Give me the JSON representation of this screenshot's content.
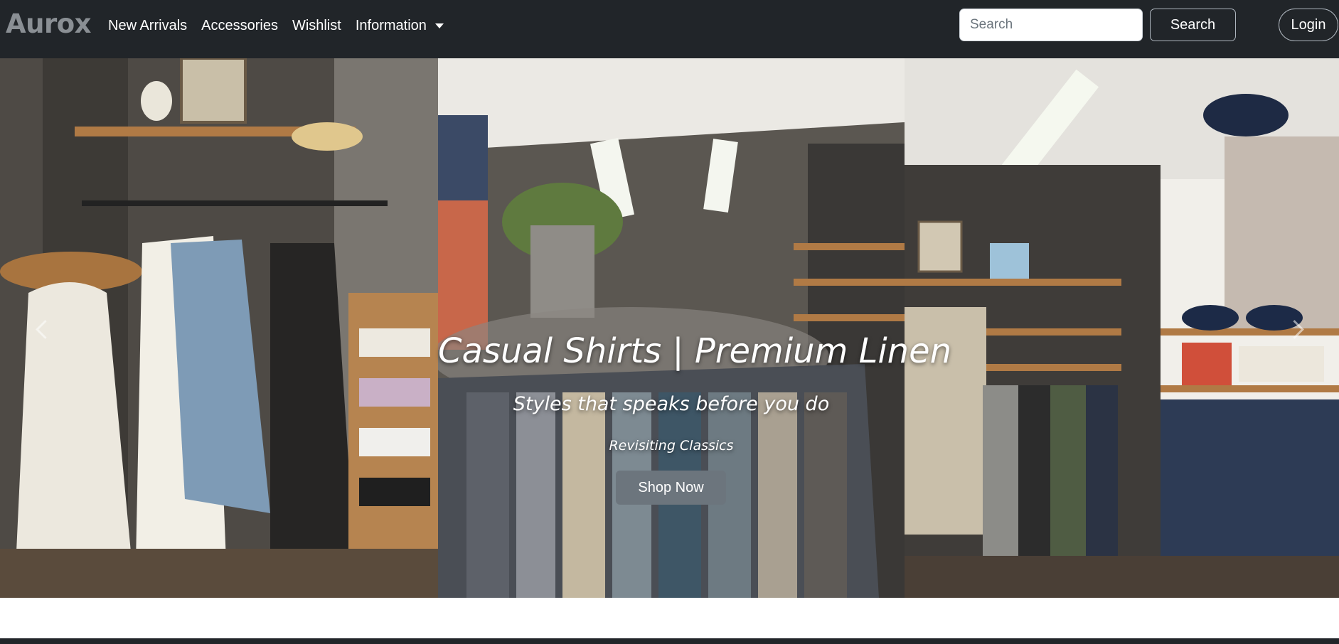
{
  "navbar": {
    "brand": "Aurox",
    "links": [
      "New Arrivals",
      "Accessories",
      "Wishlist"
    ],
    "dropdown_label": "Information",
    "search_placeholder": "Search",
    "search_button": "Search",
    "login_button": "Login"
  },
  "hero": {
    "title": "Casual Shirts | Premium Linen",
    "subtitle": "Styles that speaks before you do",
    "tagline": "Revisiting Classics",
    "cta_label": "Shop Now"
  },
  "colors": {
    "navbar_bg": "#212529",
    "brand": "#8a8f94",
    "cta_bg": "#6c757d"
  }
}
